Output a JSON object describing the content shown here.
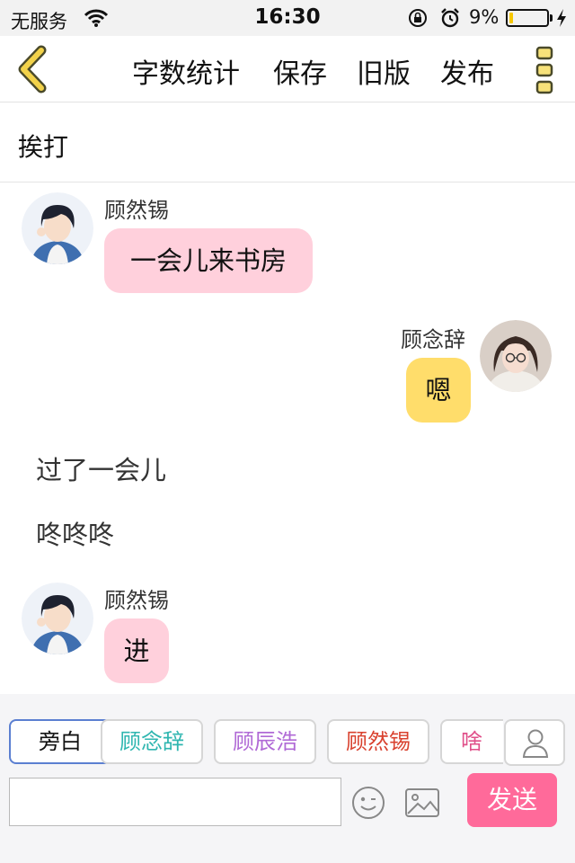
{
  "status_bar": {
    "carrier": "无服务",
    "time": "16:30",
    "battery_percent_label": "9%",
    "battery_level": 0.09,
    "battery_color": "#f6c700"
  },
  "nav": {
    "back_icon": "chevron-left-icon",
    "items": [
      "字数统计",
      "保存",
      "旧版",
      "发布"
    ],
    "more_icon": "more-vertical-icon",
    "accent_color": "#f2d24a"
  },
  "title": "挨打",
  "messages": [
    {
      "type": "left",
      "speaker": "顾然锡",
      "text": "一会儿来书房"
    },
    {
      "type": "right",
      "speaker": "顾念辞",
      "text": "嗯"
    },
    {
      "type": "narration",
      "text": "过了一会儿"
    },
    {
      "type": "narration",
      "text": "咚咚咚"
    },
    {
      "type": "left",
      "speaker": "顾然锡",
      "text": "进"
    }
  ],
  "characters": [
    {
      "label": "旁白",
      "color": "#111111"
    },
    {
      "label": "顾念辞",
      "color": "#2fb6b0"
    },
    {
      "label": "顾辰浩",
      "color": "#b06ad6"
    },
    {
      "label": "顾然锡",
      "color": "#d9412e"
    },
    {
      "label": "啥都",
      "color": "#e0508a"
    }
  ],
  "composer": {
    "input_value": "",
    "send_label": "发送",
    "send_color": "#ff6a9a"
  }
}
